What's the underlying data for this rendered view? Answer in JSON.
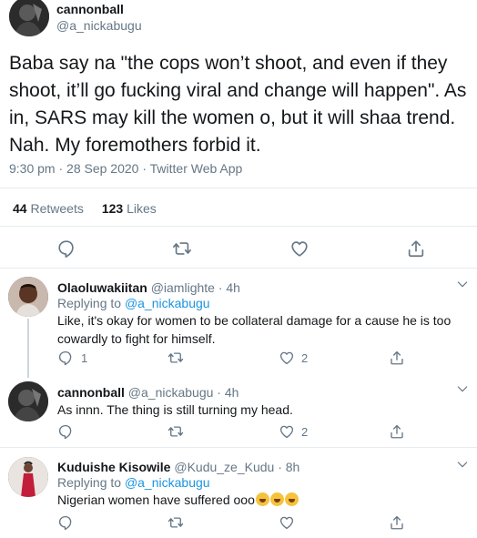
{
  "main_tweet": {
    "name": "cannonball",
    "handle": "@a_nickabugu",
    "text": "Baba say na \"the cops won’t shoot, and even if they shoot, it’ll go fucking viral and change will happen\". As in, SARS may kill the women o, but it will shaa trend. Nah. My foremothers forbid it.",
    "meta": "9:30 pm · 28 Sep 2020 · Twitter Web App",
    "retweets_count": "44",
    "retweets_label": "Retweets",
    "likes_count": "123",
    "likes_label": "Likes"
  },
  "replies": [
    {
      "name": "Olaoluwakiitan",
      "handle": "@iamlighte · 4h",
      "replying_label": "Replying to",
      "replying_to": "@a_nickabugu",
      "text": "Like, it's okay for women to be collateral damage for a cause he is too cowardly to fight for himself.",
      "reply_count": "1",
      "like_count": "2"
    },
    {
      "name": "cannonball",
      "handle": "@a_nickabugu · 4h",
      "text": "As innn. The thing is still turning my head.",
      "like_count": "2"
    },
    {
      "name": "Kuduishe Kisowile",
      "handle": "@Kudu_ze_Kudu · 8h",
      "replying_label": "Replying to",
      "replying_to": "@a_nickabugu",
      "text": "Nigerian women have suffered ooo",
      "emoji_names": [
        "crying-face-emoji",
        "crying-face-emoji",
        "crying-face-emoji"
      ]
    }
  ],
  "colors": {
    "text": "#14171a",
    "secondary": "#657786",
    "link": "#1b95e0",
    "divider": "#e6ecf0"
  },
  "icons": [
    "reply-icon",
    "retweet-icon",
    "like-icon",
    "share-icon",
    "chevron-down-icon"
  ]
}
